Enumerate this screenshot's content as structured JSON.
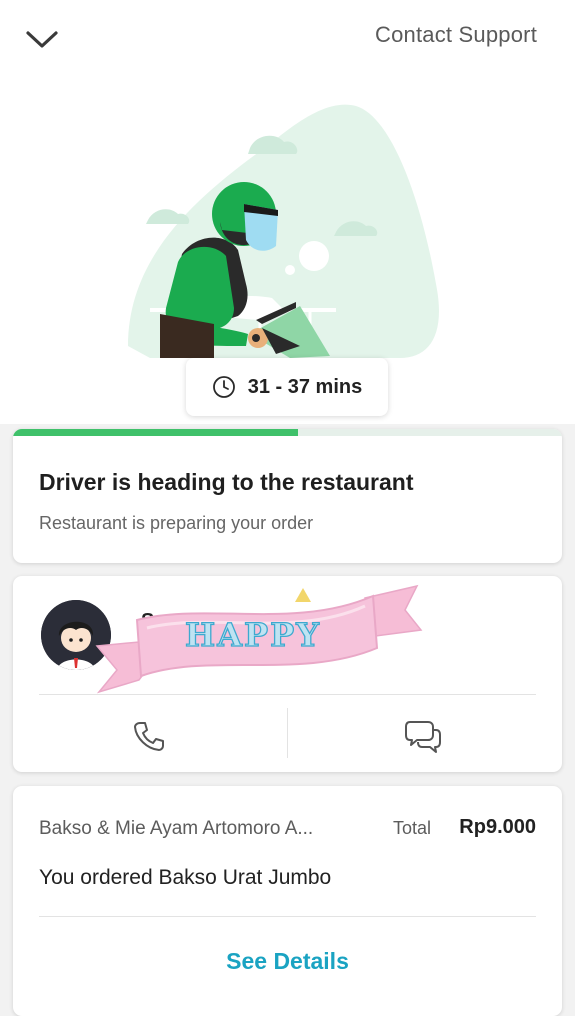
{
  "header": {
    "support_label": "Contact Support",
    "back_icon": "chevron-down-icon"
  },
  "eta": {
    "icon": "clock-icon",
    "text": "31 - 37 mins"
  },
  "status": {
    "title": "Driver is heading to the restaurant",
    "subtitle": "Restaurant is preparing your order",
    "progress_fraction": 0.52,
    "progress_color": "#3fc16a"
  },
  "driver": {
    "name_partial": "S",
    "sticker_text": "HAPPY",
    "call_icon": "phone-icon",
    "chat_icon": "chat-bubbles-icon"
  },
  "order": {
    "restaurant": "Bakso & Mie Ayam Artomoro A...",
    "total_label": "Total",
    "total_value": "Rp9.000",
    "items_text": "You ordered Bakso Urat Jumbo",
    "details_label": "See Details"
  },
  "colors": {
    "brand_green": "#3fc16a",
    "helmet_green": "#1bab4f",
    "link_blue": "#1aa3c2",
    "ribbon_pink": "#f6bdd6"
  }
}
